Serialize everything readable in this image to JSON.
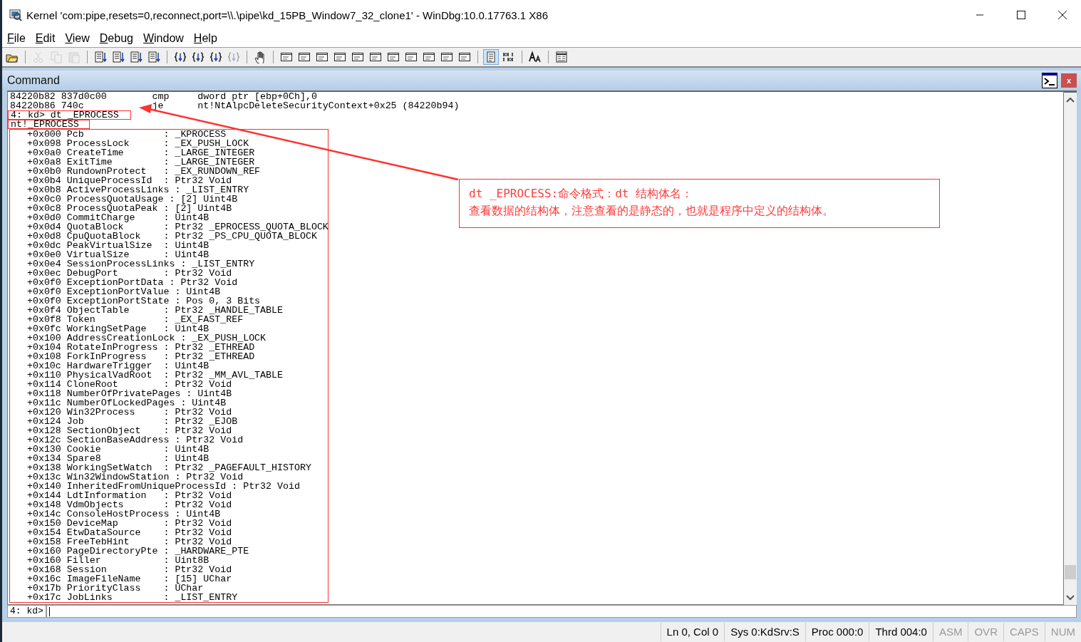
{
  "window": {
    "title": "Kernel 'com:pipe,resets=0,reconnect,port=\\\\.\\pipe\\kd_15PB_Window7_32_clone1' - WinDbg:10.0.17763.1 X86"
  },
  "menu": [
    {
      "label": "File"
    },
    {
      "label": "Edit"
    },
    {
      "label": "View"
    },
    {
      "label": "Debug"
    },
    {
      "label": "Window"
    },
    {
      "label": "Help"
    }
  ],
  "toolbar": [
    {
      "kind": "open",
      "disabled": false,
      "pressed": false
    },
    {
      "kind": "separator"
    },
    {
      "kind": "cut",
      "disabled": true,
      "pressed": false
    },
    {
      "kind": "copy",
      "disabled": true,
      "pressed": false
    },
    {
      "kind": "paste",
      "disabled": true,
      "pressed": false
    },
    {
      "kind": "separator"
    },
    {
      "kind": "code",
      "disabled": false,
      "pressed": false
    },
    {
      "kind": "code",
      "disabled": false,
      "pressed": false
    },
    {
      "kind": "code",
      "disabled": false,
      "pressed": false
    },
    {
      "kind": "code",
      "disabled": false,
      "pressed": false
    },
    {
      "kind": "separator"
    },
    {
      "kind": "brace",
      "disabled": false,
      "pressed": false
    },
    {
      "kind": "brace",
      "disabled": false,
      "pressed": false
    },
    {
      "kind": "brace",
      "disabled": false,
      "pressed": false
    },
    {
      "kind": "brace",
      "disabled": true,
      "pressed": false
    },
    {
      "kind": "separator"
    },
    {
      "kind": "hand",
      "disabled": false,
      "pressed": false
    },
    {
      "kind": "separator"
    },
    {
      "kind": "window",
      "disabled": false,
      "pressed": false
    },
    {
      "kind": "window",
      "disabled": false,
      "pressed": false
    },
    {
      "kind": "window",
      "disabled": false,
      "pressed": false
    },
    {
      "kind": "window",
      "disabled": false,
      "pressed": false
    },
    {
      "kind": "window",
      "disabled": false,
      "pressed": false
    },
    {
      "kind": "window",
      "disabled": false,
      "pressed": false
    },
    {
      "kind": "window",
      "disabled": false,
      "pressed": false
    },
    {
      "kind": "window",
      "disabled": false,
      "pressed": false
    },
    {
      "kind": "window",
      "disabled": false,
      "pressed": false
    },
    {
      "kind": "window",
      "disabled": false,
      "pressed": false
    },
    {
      "kind": "window",
      "disabled": false,
      "pressed": false
    },
    {
      "kind": "separator"
    },
    {
      "kind": "source",
      "disabled": false,
      "pressed": true
    },
    {
      "kind": "binary",
      "disabled": false,
      "pressed": false
    },
    {
      "kind": "separator"
    },
    {
      "kind": "font",
      "disabled": false,
      "pressed": false
    },
    {
      "kind": "separator"
    },
    {
      "kind": "settings",
      "disabled": false,
      "pressed": false
    }
  ],
  "command_window": {
    "title": "Command",
    "close": "x",
    "disassembly": [
      "84220b82 837d0c00        cmp     dword ptr [ebp+0Ch],0",
      "84220b86 740c            je      nt!NtAlpcDeleteSecurityContext+0x25 (84220b94)"
    ],
    "command": "4: kd> dt _EPROCESS",
    "type_name": "nt!_EPROCESS",
    "fields": [
      "   +0x000 Pcb              : _KPROCESS",
      "   +0x098 ProcessLock      : _EX_PUSH_LOCK",
      "   +0x0a0 CreateTime       : _LARGE_INTEGER",
      "   +0x0a8 ExitTime         : _LARGE_INTEGER",
      "   +0x0b0 RundownProtect   : _EX_RUNDOWN_REF",
      "   +0x0b4 UniqueProcessId  : Ptr32 Void",
      "   +0x0b8 ActiveProcessLinks : _LIST_ENTRY",
      "   +0x0c0 ProcessQuotaUsage : [2] Uint4B",
      "   +0x0c8 ProcessQuotaPeak : [2] Uint4B",
      "   +0x0d0 CommitCharge     : Uint4B",
      "   +0x0d4 QuotaBlock       : Ptr32 _EPROCESS_QUOTA_BLOCK",
      "   +0x0d8 CpuQuotaBlock    : Ptr32 _PS_CPU_QUOTA_BLOCK",
      "   +0x0dc PeakVirtualSize  : Uint4B",
      "   +0x0e0 VirtualSize      : Uint4B",
      "   +0x0e4 SessionProcessLinks : _LIST_ENTRY",
      "   +0x0ec DebugPort        : Ptr32 Void",
      "   +0x0f0 ExceptionPortData : Ptr32 Void",
      "   +0x0f0 ExceptionPortValue : Uint4B",
      "   +0x0f0 ExceptionPortState : Pos 0, 3 Bits",
      "   +0x0f4 ObjectTable      : Ptr32 _HANDLE_TABLE",
      "   +0x0f8 Token            : _EX_FAST_REF",
      "   +0x0fc WorkingSetPage   : Uint4B",
      "   +0x100 AddressCreationLock : _EX_PUSH_LOCK",
      "   +0x104 RotateInProgress : Ptr32 _ETHREAD",
      "   +0x108 ForkInProgress   : Ptr32 _ETHREAD",
      "   +0x10c HardwareTrigger  : Uint4B",
      "   +0x110 PhysicalVadRoot  : Ptr32 _MM_AVL_TABLE",
      "   +0x114 CloneRoot        : Ptr32 Void",
      "   +0x118 NumberOfPrivatePages : Uint4B",
      "   +0x11c NumberOfLockedPages : Uint4B",
      "   +0x120 Win32Process     : Ptr32 Void",
      "   +0x124 Job              : Ptr32 _EJOB",
      "   +0x128 SectionObject    : Ptr32 Void",
      "   +0x12c SectionBaseAddress : Ptr32 Void",
      "   +0x130 Cookie           : Uint4B",
      "   +0x134 Spare8           : Uint4B",
      "   +0x138 WorkingSetWatch  : Ptr32 _PAGEFAULT_HISTORY",
      "   +0x13c Win32WindowStation : Ptr32 Void",
      "   +0x140 InheritedFromUniqueProcessId : Ptr32 Void",
      "   +0x144 LdtInformation   : Ptr32 Void",
      "   +0x148 VdmObjects       : Ptr32 Void",
      "   +0x14c ConsoleHostProcess : Uint4B",
      "   +0x150 DeviceMap        : Ptr32 Void",
      "   +0x154 EtwDataSource    : Ptr32 Void",
      "   +0x158 FreeTebHint      : Ptr32 Void",
      "   +0x160 PageDirectoryPte : _HARDWARE_PTE",
      "   +0x160 Filler           : Uint8B",
      "   +0x168 Session          : Ptr32 Void",
      "   +0x16c ImageFileName    : [15] UChar",
      "   +0x17b PriorityClass    : UChar",
      "   +0x17c JobLinks         : _LIST_ENTRY"
    ],
    "prompt": "4: kd>"
  },
  "annotation": {
    "lines": [
      "dt _EPROCESS:命令格式：dt 结构体名：",
      "查看数据的结构体，注意查看的是静态的，也就是程序中定义的结构体。"
    ]
  },
  "status_bar": [
    {
      "text": "Ln 0, Col 0",
      "disabled": false
    },
    {
      "text": "Sys 0:KdSrv:S",
      "disabled": false
    },
    {
      "text": "Proc 000:0",
      "disabled": false
    },
    {
      "text": "Thrd 004:0",
      "disabled": false
    },
    {
      "text": "ASM",
      "disabled": true
    },
    {
      "text": "OVR",
      "disabled": true
    },
    {
      "text": "CAPS",
      "disabled": true
    },
    {
      "text": "NUM",
      "disabled": true
    }
  ]
}
